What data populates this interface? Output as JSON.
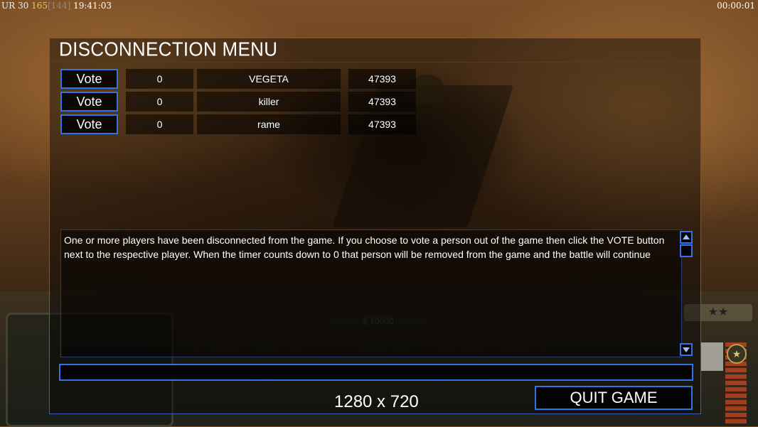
{
  "status_bar": {
    "region": "UR",
    "value1": "30",
    "value2": "165",
    "value3": "[144]",
    "clock": "19:41:03",
    "game_timer": "00:00:01"
  },
  "hud": {
    "money": "$ 10000",
    "rank_stars": "★★"
  },
  "dialog": {
    "title": "DISCONNECTION MENU",
    "players": [
      {
        "vote_label": "Vote",
        "count": "0",
        "name": "VEGETA",
        "ping": "47393"
      },
      {
        "vote_label": "Vote",
        "count": "0",
        "name": "killer",
        "ping": "47393"
      },
      {
        "vote_label": "Vote",
        "count": "0",
        "name": "rame",
        "ping": "47393"
      }
    ],
    "message": "One or more players have been disconnected from the game. If you choose to vote a person out of the game then click the VOTE button next to the respective player. When the timer counts down to 0 that person will be removed from the game and the battle will continue",
    "chat_value": "",
    "resolution": "1280 x 720",
    "quit_label": "QUIT GAME"
  },
  "colors": {
    "accent": "#2e74e6",
    "frame": "#3e5cbe",
    "money_highlight": "#f3c64a"
  }
}
